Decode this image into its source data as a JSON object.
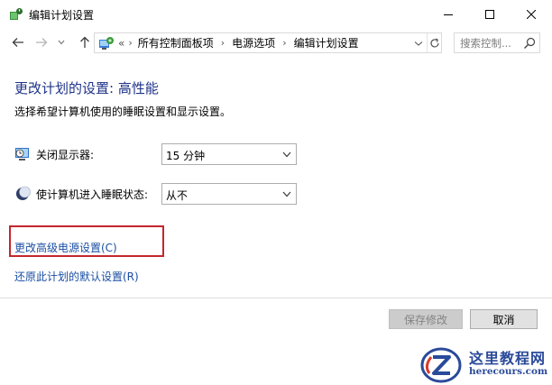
{
  "window": {
    "title": "编辑计划设置",
    "controls": {
      "minimize": "minimize-icon",
      "maximize": "maximize-icon",
      "close": "close-icon"
    }
  },
  "nav": {
    "back_icon": "arrow-left-icon",
    "forward_icon": "arrow-right-icon",
    "recent_icon": "chevron-down-icon",
    "up_icon": "arrow-up-icon",
    "address": {
      "prefix": "«",
      "crumbs": [
        "所有控制面板项",
        "电源选项",
        "编辑计划设置"
      ],
      "separator": "›"
    },
    "search": {
      "placeholder": "搜索控制...",
      "value": ""
    }
  },
  "main": {
    "heading": "更改计划的设置: 高性能",
    "subheading": "选择希望计算机使用的睡眠设置和显示设置。",
    "settings": [
      {
        "label": "关闭显示器:",
        "value": "15 分钟",
        "icon": "display-timer-icon"
      },
      {
        "label": "使计算机进入睡眠状态:",
        "value": "从不",
        "icon": "sleep-moon-icon"
      }
    ],
    "links": {
      "advanced": "更改高级电源设置(C)",
      "restore": "还原此计划的默认设置(R)"
    },
    "highlight_color": "#c4262e",
    "heading_color": "#1e3287",
    "link_color": "#1a4ea3"
  },
  "footer": {
    "save_label": "保存修改",
    "cancel_label": "取消"
  },
  "watermark": {
    "name": "这里教程网",
    "url": "herecours.com"
  }
}
